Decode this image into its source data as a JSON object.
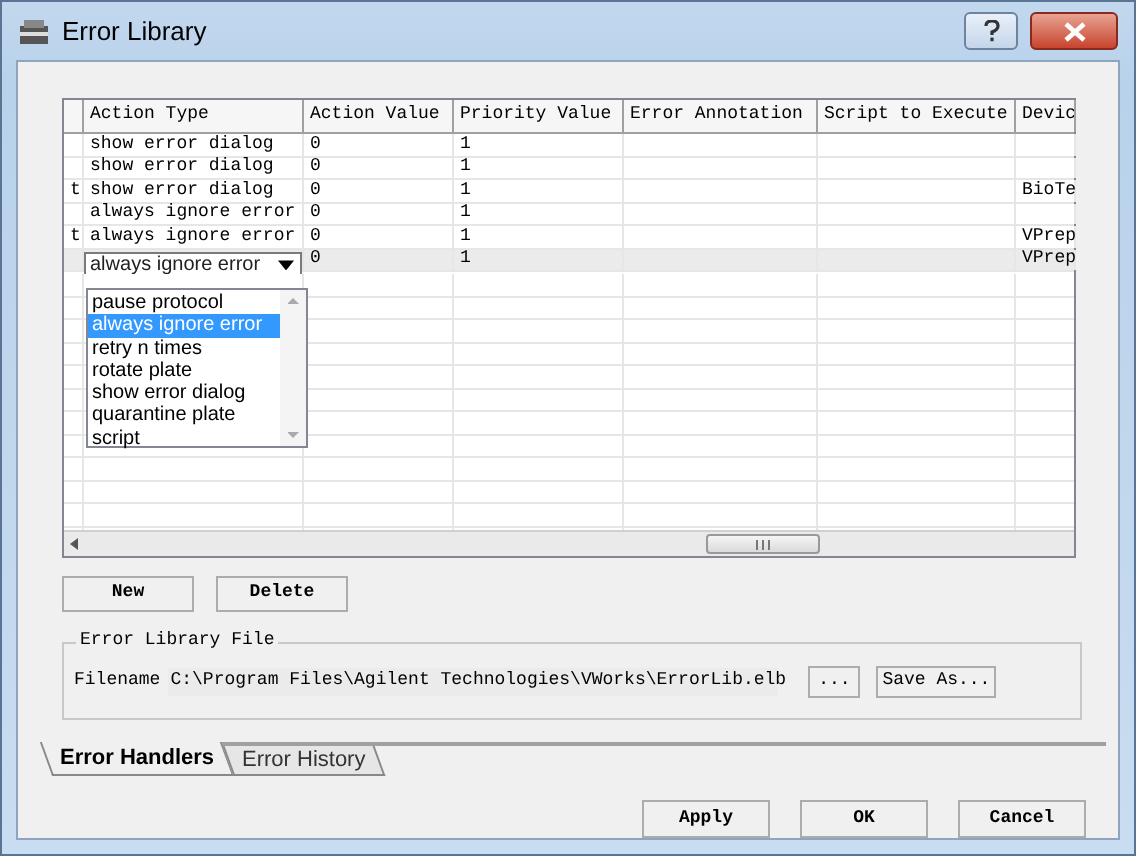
{
  "window": {
    "title": "Error Library"
  },
  "table": {
    "columns": [
      {
        "label": "Action Type"
      },
      {
        "label": "Action Value"
      },
      {
        "label": "Priority Value"
      },
      {
        "label": "Error Annotation"
      },
      {
        "label": "Script to Execute"
      },
      {
        "label": "Devic"
      }
    ],
    "rows": [
      {
        "column_1": "",
        "action_type": "show error dialog",
        "action_value": "0",
        "priority_value": "1",
        "device": "",
        "selected": false
      },
      {
        "column_1": "",
        "action_type": "show error dialog",
        "action_value": "0",
        "priority_value": "1",
        "device": "",
        "selected": false
      },
      {
        "column_1": "t",
        "action_type": "show error dialog",
        "action_value": "0",
        "priority_value": "1",
        "device": "BioTe",
        "selected": false
      },
      {
        "column_1": "",
        "action_type": "always ignore error",
        "action_value": "0",
        "priority_value": "1",
        "device": "",
        "selected": false
      },
      {
        "column_1": "t",
        "action_type": "always ignore error",
        "action_value": "0",
        "priority_value": "1",
        "device": "VPrep",
        "selected": false
      },
      {
        "column_1": "",
        "action_type": "always ignore error",
        "action_value": "0",
        "priority_value": "1",
        "device": "VPrep",
        "selected": true
      }
    ]
  },
  "dropdown": {
    "options": [
      {
        "label": "pause protocol",
        "selected": false
      },
      {
        "label": "always ignore error",
        "selected": true
      },
      {
        "label": "retry n times",
        "selected": false
      },
      {
        "label": "rotate plate",
        "selected": false
      },
      {
        "label": "show error dialog",
        "selected": false
      },
      {
        "label": "quarantine plate",
        "selected": false
      },
      {
        "label": "script",
        "selected": false
      }
    ]
  },
  "buttons": [
    {
      "label": "New"
    },
    {
      "label": "Delete"
    }
  ],
  "file_group": {
    "title": "Error Library File",
    "label": "Filename",
    "value": "C:\\Program Files\\Agilent Technologies\\VWorks\\ErrorLib.elb",
    "browse": "...",
    "save_as": "Save As..."
  },
  "tabs": [
    {
      "label": "Error Handlers",
      "selected": true
    },
    {
      "label": "Error History",
      "selected": false
    }
  ],
  "footer_buttons": [
    {
      "label": "Apply"
    },
    {
      "label": "OK"
    },
    {
      "label": "Cancel"
    }
  ]
}
